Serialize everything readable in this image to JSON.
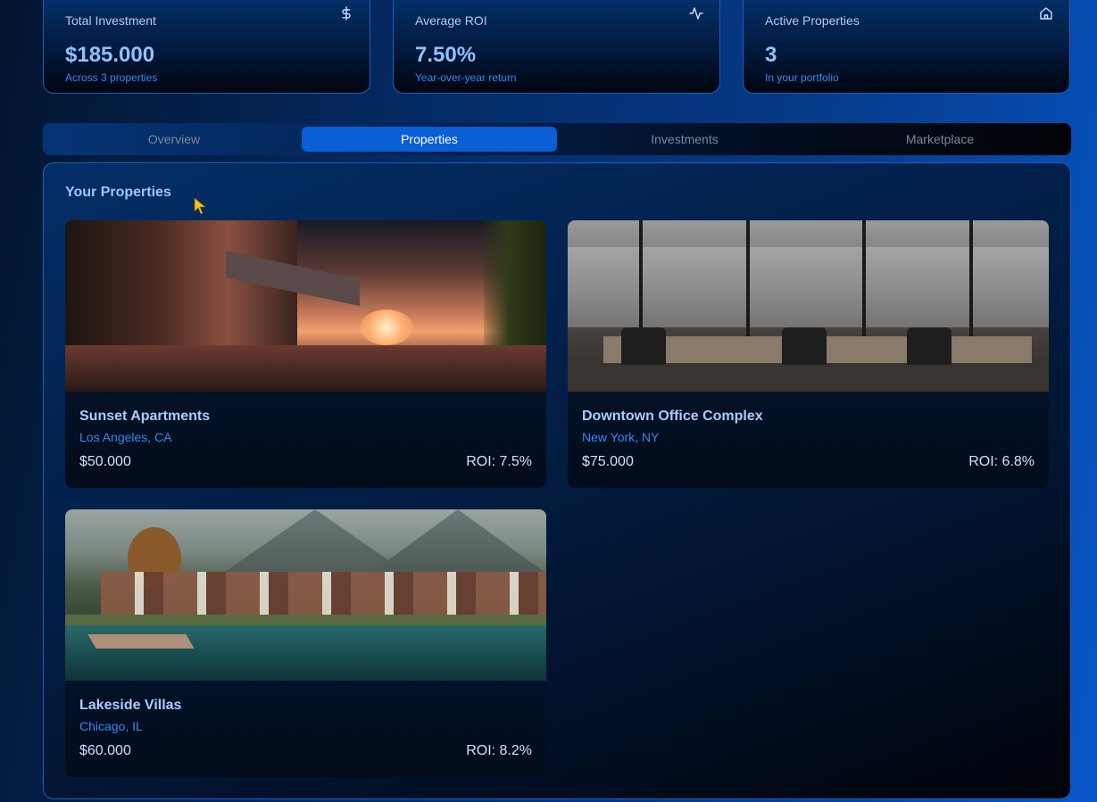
{
  "stats": [
    {
      "title": "Total Investment",
      "value": "$185.000",
      "sub": "Across 3 properties",
      "icon": "dollar-icon"
    },
    {
      "title": "Average ROI",
      "value": "7.50%",
      "sub": "Year-over-year return",
      "icon": "activity-icon"
    },
    {
      "title": "Active Properties",
      "value": "3",
      "sub": "In your portfolio",
      "icon": "home-icon"
    }
  ],
  "tabs": [
    {
      "label": "Overview",
      "active": false
    },
    {
      "label": "Properties",
      "active": true
    },
    {
      "label": "Investments",
      "active": false
    },
    {
      "label": "Marketplace",
      "active": false
    }
  ],
  "properties_panel": {
    "title": "Your Properties",
    "items": [
      {
        "name": "Sunset Apartments",
        "location": "Los Angeles, CA",
        "price": "$50.000",
        "roi": "ROI: 7.5%"
      },
      {
        "name": "Downtown Office Complex",
        "location": "New York, NY",
        "price": "$75.000",
        "roi": "ROI: 6.8%"
      },
      {
        "name": "Lakeside Villas",
        "location": "Chicago, IL",
        "price": "$60.000",
        "roi": "ROI: 8.2%"
      }
    ]
  },
  "colors": {
    "accent": "#0a5ed6",
    "value_text": "#8ec2ff",
    "sub_text": "#2f8bf0",
    "cursor": "#f2c21b"
  }
}
